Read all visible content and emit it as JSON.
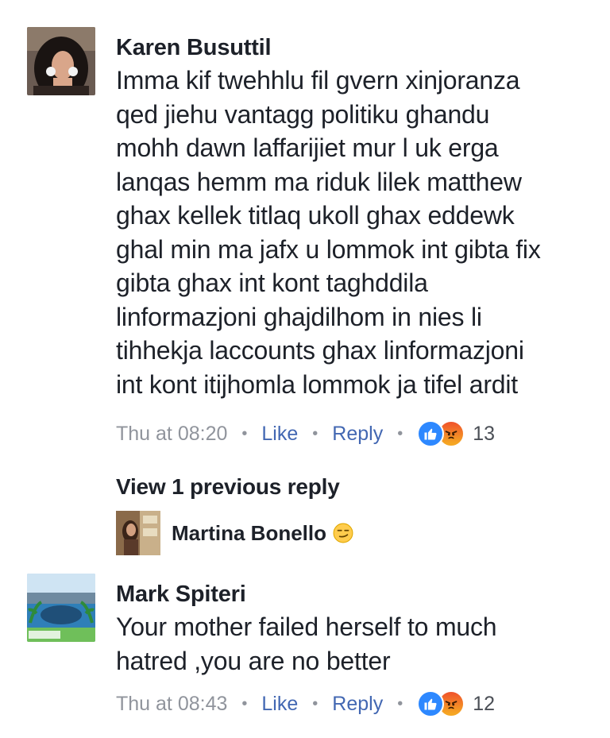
{
  "comments": [
    {
      "author": "Karen Busuttil",
      "avatar": "profile-photo-woman",
      "lines": [
        "Imma kif twehhlu fil gvern xinjoranza",
        "qed jiehu vantagg politiku ghandu",
        "mohh dawn laffarijiet mur l uk erga",
        "lanqas hemm ma riduk lilek matthew",
        "ghax kellek titlaq ukoll ghax eddewk",
        "ghal min ma jafx u lommok int gibta fix",
        "gibta ghax int kont taghddila",
        "linformazjoni ghajdilhom in nies li",
        "tihhekja laccounts ghax linformazjoni",
        "int kont itijhomla lommok ja tifel ardit"
      ],
      "time": "Thu at 08:20",
      "like_label": "Like",
      "reply_label": "Reply",
      "reactions": [
        "like-icon",
        "angry-icon"
      ],
      "reaction_count": "13"
    },
    {
      "author": "Mark Spiteri",
      "avatar": "profile-photo-landscape",
      "lines": [
        "Your mother failed herself to much",
        "hatred ,you are no better"
      ],
      "time": "Thu at 08:43",
      "like_label": "Like",
      "reply_label": "Reply",
      "reactions": [
        "like-icon",
        "angry-icon"
      ],
      "reaction_count": "12"
    }
  ],
  "replies": {
    "view_previous_label": "View 1 previous reply",
    "preview_author": "Martina Bonello",
    "preview_emoji": "smirk-emoji"
  },
  "colors": {
    "text": "#1d2129",
    "meta": "#90949c",
    "link": "#4267b2",
    "like": "#2d88ff",
    "angry": "#f0522c"
  }
}
